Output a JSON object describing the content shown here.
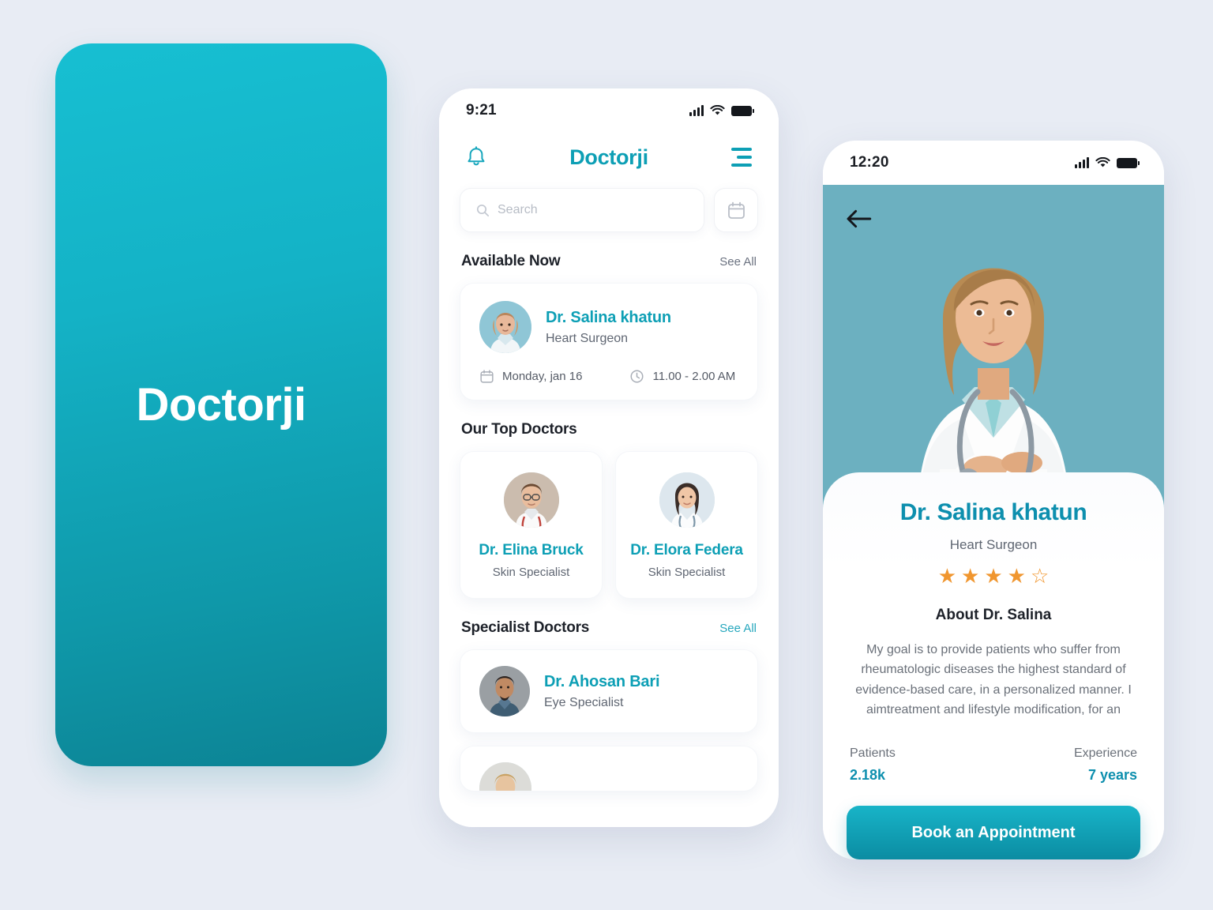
{
  "background_color": "#e8ecf4",
  "brand": {
    "accent": "#0d9fb5",
    "accent_dark": "#0b8ca2",
    "star": "#f0962f"
  },
  "splash": {
    "logo": "Doctorji"
  },
  "home": {
    "status": {
      "time": "9:21",
      "signal_icon": "signal-bars-icon",
      "wifi_icon": "wifi-icon",
      "battery_icon": "battery-icon"
    },
    "header": {
      "title": "Doctorji",
      "bell_icon": "bell-icon",
      "menu_icon": "hamburger-menu-icon"
    },
    "search": {
      "placeholder": "Search",
      "icon": "search-icon"
    },
    "calendar_button_icon": "calendar-icon",
    "available": {
      "title": "Available Now",
      "see_all": "See All",
      "doctor": {
        "name": "Dr. Salina khatun",
        "specialty": "Heart Surgeon",
        "date": "Monday, jan 16",
        "date_icon": "calendar-icon",
        "time": "11.00 - 2.00 AM",
        "time_icon": "clock-icon"
      }
    },
    "top_doctors": {
      "title": "Our Top Doctors",
      "items": [
        {
          "name": "Dr. Elina Bruck",
          "specialty": "Skin Specialist"
        },
        {
          "name": "Dr. Elora Federa",
          "specialty": "Skin Specialist"
        }
      ]
    },
    "specialist": {
      "title": "Specialist Doctors",
      "see_all": "See All",
      "items": [
        {
          "name": "Dr. Ahosan Bari",
          "specialty": "Eye Specialist"
        }
      ]
    }
  },
  "profile": {
    "status": {
      "time": "12:20"
    },
    "back_icon": "back-arrow-icon",
    "name": "Dr. Salina khatun",
    "specialty": "Heart Surgeon",
    "rating": {
      "filled": 4,
      "total": 5
    },
    "about_heading": "About Dr. Salina",
    "about_text": "My goal is to provide patients who suffer from rheumatologic diseases the highest standard of evidence-based care, in a personalized manner. I aimtreatment and lifestyle modification, for an",
    "stats": [
      {
        "label": "Patients",
        "value": "2.18k"
      },
      {
        "label": "Experience",
        "value": "7 years"
      }
    ],
    "book_button": "Book an Appointment"
  }
}
